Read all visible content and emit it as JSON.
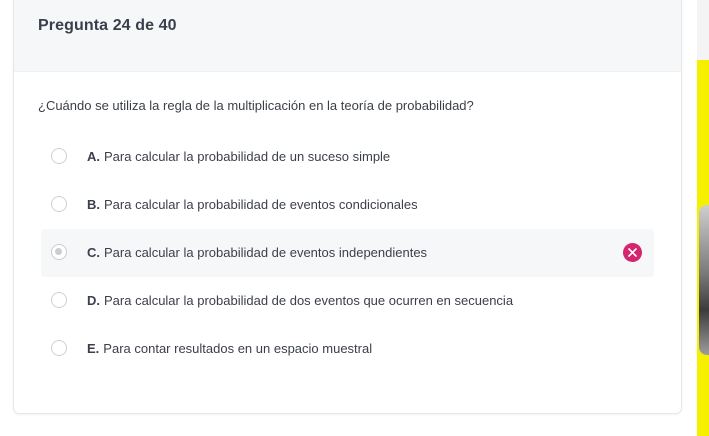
{
  "header": {
    "title": "Pregunta 24 de 40"
  },
  "question": {
    "text": "¿Cuándo se utiliza la regla de la multiplicación en la teoría de probabilidad?"
  },
  "options": [
    {
      "letter": "A.",
      "text": "Para calcular la probabilidad de un suceso simple",
      "selected": false
    },
    {
      "letter": "B.",
      "text": "Para calcular la probabilidad de eventos condicionales",
      "selected": false
    },
    {
      "letter": "C.",
      "text": "Para calcular la probabilidad de eventos independientes",
      "selected": true,
      "status": "incorrect"
    },
    {
      "letter": "D.",
      "text": "Para calcular la probabilidad de dos eventos que ocurren en secuencia",
      "selected": false
    },
    {
      "letter": "E.",
      "text": "Para contar resultados en un espacio muestral",
      "selected": false
    }
  ],
  "icons": {
    "incorrect": "close-circle-icon"
  },
  "colors": {
    "incorrect": "#d4266f",
    "accent_strip": "#f6ef00",
    "selected_bg": "#f6f7f9"
  }
}
